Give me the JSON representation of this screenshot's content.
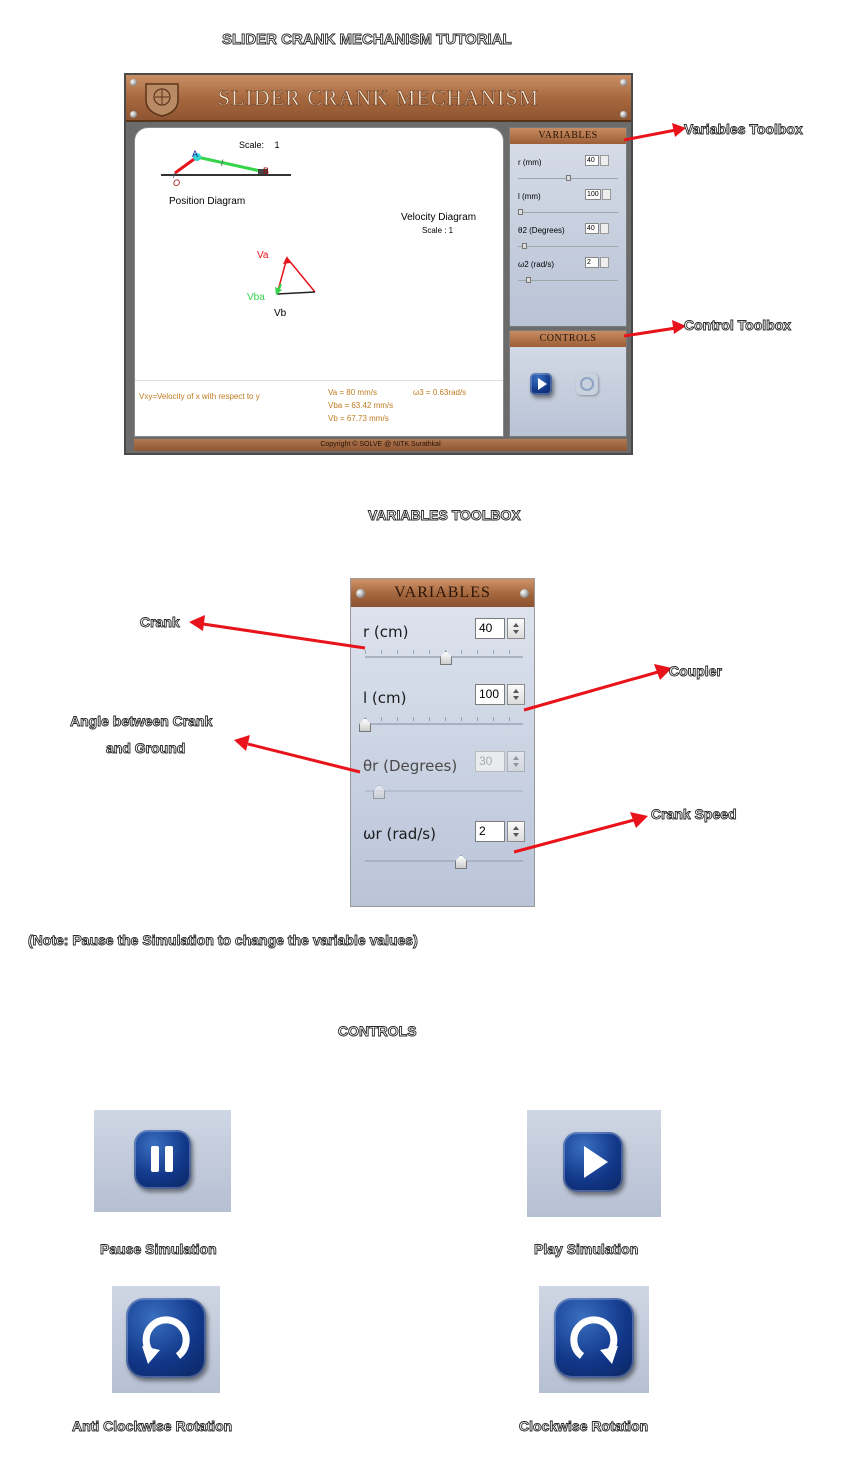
{
  "page": {
    "heading": "SLIDER CRANK MECHANISM TUTORIAL",
    "variables_heading": "VARIABLES TOOLBOX",
    "controls_heading": "CONTROLS",
    "note": "(Note: Pause the Simulation to change the variable values)"
  },
  "app": {
    "title": "SLIDER CRANK MECHANISM",
    "footer": "Copyright © SOLVE @ NITK Surathkal",
    "position_diagram": {
      "scale_label": "Scale:",
      "scale_value": "1",
      "label": "Position Diagram",
      "point_o": "O",
      "point_a": "A",
      "point_b": "B",
      "link_r": "r",
      "link_l": "l"
    },
    "velocity_diagram": {
      "label": "Velocity Diagram",
      "scale": "Scale :  1",
      "va": "Va",
      "vba": "Vba",
      "vb": "Vb"
    },
    "legend": "Vxy=Velocity of x with respect to y",
    "results": {
      "va": "Va   = 80 mm/s",
      "w3": "ω3   = 0.63rad/s",
      "vba": "Vba = 63.42 mm/s",
      "vb": "Vb   = 67.73 mm/s"
    },
    "variables_panel": {
      "header": "VARIABLES",
      "r_label": "r (mm)",
      "r_value": "40",
      "l_label": "l (mm)",
      "l_value": "100",
      "theta_label": "θ2 (Degrees)",
      "theta_value": "40",
      "omega_label": "ω2 (rad/s)",
      "omega_value": "2"
    },
    "controls_panel": {
      "header": "CONTROLS"
    }
  },
  "annotations": {
    "variables_toolbox": "Variables Toolbox",
    "control_toolbox": "Control Toolbox",
    "crank": "Crank",
    "coupler": "Coupler",
    "angle_line1": "Angle between  Crank",
    "angle_line2": "and Ground",
    "crank_speed": "Crank Speed"
  },
  "big_toolbox": {
    "header": "VARIABLES",
    "r_label": "r (cm)",
    "r_value": "40",
    "l_label": "l (cm)",
    "l_value": "100",
    "theta_label": "θr (Degrees)",
    "theta_value": "30",
    "omega_label": "ωr (rad/s)",
    "omega_value": "2"
  },
  "controls": {
    "pause": "Pause Simulation",
    "play": "Play Simulation",
    "anticlockwise": "Anti Clockwise Rotation",
    "clockwise": "Clockwise Rotation"
  },
  "colors": {
    "arrow": "#e8131b",
    "crank_link": "#35d44a",
    "velocity_va": "#e8131b",
    "velocity_vba": "#35d44a"
  }
}
